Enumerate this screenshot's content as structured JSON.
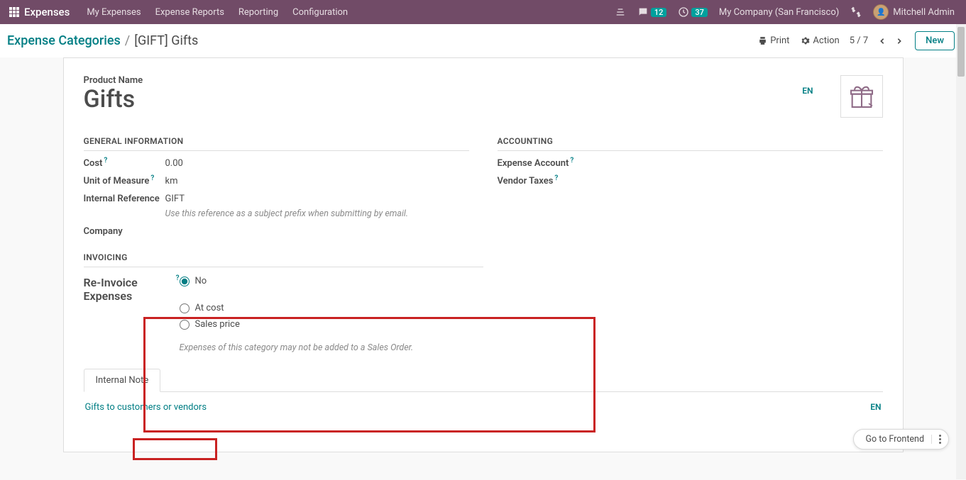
{
  "nav": {
    "brand": "Expenses",
    "menu": [
      "My Expenses",
      "Expense Reports",
      "Reporting",
      "Configuration"
    ],
    "msg_count": "12",
    "activity_count": "37",
    "company": "My Company (San Francisco)",
    "user": "Mitchell Admin"
  },
  "cp": {
    "breadcrumb_root": "Expense Categories",
    "breadcrumb_current": "[GIFT] Gifts",
    "print": "Print",
    "action": "Action",
    "pager": "5 / 7",
    "new": "New"
  },
  "form": {
    "title_label": "Product Name",
    "title": "Gifts",
    "lang": "EN",
    "sections": {
      "general": "GENERAL INFORMATION",
      "accounting": "ACCOUNTING",
      "invoicing": "INVOICING"
    },
    "labels": {
      "cost": "Cost",
      "uom": "Unit of Measure",
      "ref": "Internal Reference",
      "company": "Company",
      "exp_account": "Expense Account",
      "vendor_taxes": "Vendor Taxes",
      "reinvoice": "Re-Invoice Expenses"
    },
    "values": {
      "cost": "0.00",
      "uom": "km",
      "ref": "GIFT"
    },
    "hints": {
      "ref": "Use this reference as a subject prefix when submitting by email.",
      "invoicing": "Expenses of this category may not be added to a Sales Order."
    },
    "radios": {
      "no": "No",
      "at_cost": "At cost",
      "sales_price": "Sales price"
    },
    "tab": "Internal Note",
    "note": "Gifts to customers or vendors",
    "note_lang": "EN"
  },
  "footer": {
    "frontend": "Go to Frontend"
  },
  "help_mark": "?"
}
